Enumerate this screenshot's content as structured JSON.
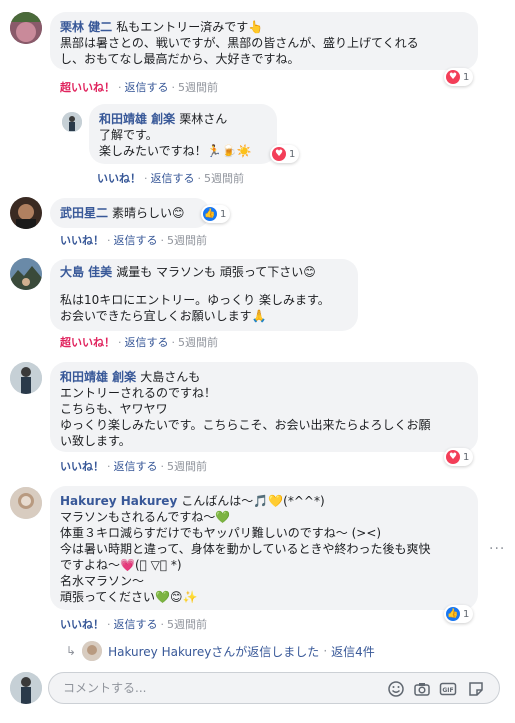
{
  "comments": [
    {
      "name": "栗林 健二",
      "lines": [
        "私もエントリー済みです👆",
        "黒部は暑さとの、戦いですが、黒部の皆さんが、盛り上げてくれるし、おもてなし最高だから、大好きですね。"
      ],
      "line1_after_name": "私もエントリー済みです👆",
      "line2": "黒部は暑さとの、戦いですが、黒部の皆さんが、盛り上げてくれる",
      "line3": "し、おもてなし最高だから、大好きですね。",
      "react_label": "超いいね！",
      "reply_label": "返信する",
      "time": "5週間前",
      "react_count": "1"
    },
    {
      "name": "和田靖雄 創楽",
      "line1_after_name": "栗林さん",
      "line2": "了解です。",
      "line3": "楽しみたいですね！🏃🍺☀️",
      "react_label": "いいね！",
      "reply_label": "返信する",
      "time": "5週間前",
      "react_count": "1"
    },
    {
      "name": "武田星二",
      "line1_after_name": "素晴らしい😊",
      "react_label": "いいね！",
      "reply_label": "返信する",
      "time": "5週間前",
      "react_count": "1"
    },
    {
      "name": "大島 佳美",
      "line1_after_name": "減量も マラソンも 頑張って下さい😊",
      "line2": "私は10キロにエントリー。ゆっくり 楽しみます。",
      "line3": "お会いできたら宜しくお願いします🙏",
      "react_label": "超いいね！",
      "reply_label": "返信する",
      "time": "5週間前"
    },
    {
      "name": "和田靖雄 創楽",
      "line1_after_name": "大島さんも",
      "line2": "エントリーされるのですね！",
      "line3": "こちらも、ヤワヤワ",
      "line4": "ゆっくり楽しみたいです。こちらこそ、お会い出来たらよろしくお願",
      "line5": "い致します。",
      "react_label": "いいね！",
      "reply_label": "返信する",
      "time": "5週間前",
      "react_count": "1"
    },
    {
      "name": "Hakurey Hakurey",
      "line1_after_name": "こんばんは〜🎵💛(*^^*)",
      "line2": "マラソンもされるんですね〜💚",
      "line3": "体重３キロ減らすだけでもヤッパリ難しいのですね〜 (><)",
      "line4": "今は暑い時期と違って、身体を動かしているときや終わった後も爽快",
      "line5": "ですよね〜💗(ﾟ ▽ﾟ *)",
      "line6": "名水マラソン〜",
      "line7": "頑張ってください💚😊✨",
      "react_label": "いいね！",
      "reply_label": "返信する",
      "time": "5週間前",
      "react_count": "1"
    }
  ],
  "reply_summary": {
    "text": "Hakurey Hakureyさんが返信しました",
    "count_label": "返信4件"
  },
  "compose": {
    "placeholder": "コメントする..."
  },
  "separator": "·",
  "more": "···"
}
